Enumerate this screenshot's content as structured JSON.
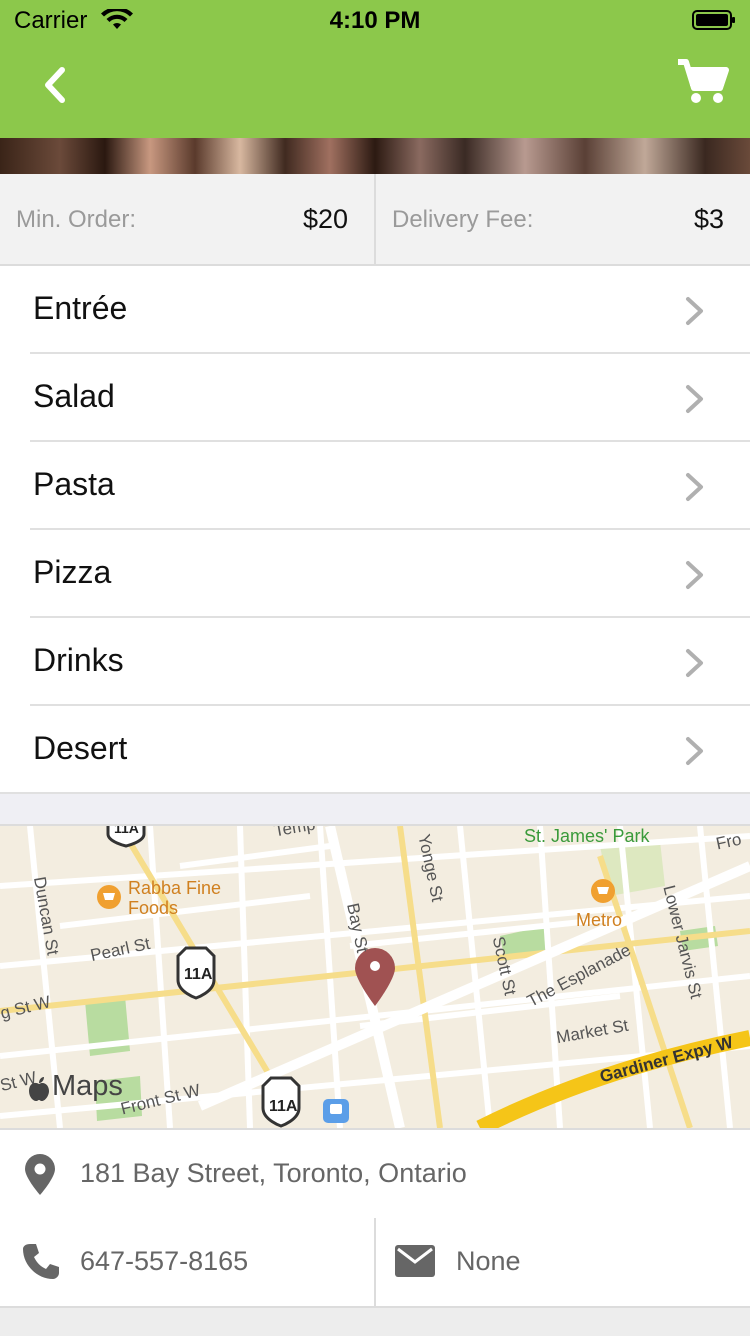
{
  "status_bar": {
    "carrier": "Carrier",
    "time": "4:10 PM"
  },
  "nav": {
    "back_icon": "chevron-left-icon",
    "cart_icon": "cart-icon",
    "accent_color": "#8cc84b"
  },
  "info": {
    "min_order_label": "Min. Order:",
    "min_order_value": "$20",
    "delivery_fee_label": "Delivery Fee:",
    "delivery_fee_value": "$3"
  },
  "menu": {
    "items": [
      {
        "label": "Entrée"
      },
      {
        "label": "Salad"
      },
      {
        "label": "Pasta"
      },
      {
        "label": "Pizza"
      },
      {
        "label": "Drinks"
      },
      {
        "label": "Desert"
      }
    ]
  },
  "map": {
    "brand": "Maps",
    "labels": {
      "st_james_park": "St. James' Park",
      "rabba_1": "Rabba Fine",
      "rabba_2": "Foods",
      "duncan": "Duncan St",
      "pearl": "Pearl St",
      "bay": "Bay St",
      "yonge": "Yonge St",
      "scott": "Scott St",
      "lower_jarvis": "Lower Jarvis St",
      "metro": "Metro",
      "esplanade": "The Esplanade",
      "market": "Market St",
      "gardiner": "Gardiner Expy W",
      "front": "Front St W",
      "king": "g St W",
      "st_w": "St W",
      "fro": "Fro",
      "temp": "Temp",
      "hw_11a": "11A"
    }
  },
  "address": {
    "text": "181 Bay Street, Toronto, Ontario"
  },
  "contact": {
    "phone": "647-557-8165",
    "email": "None"
  }
}
